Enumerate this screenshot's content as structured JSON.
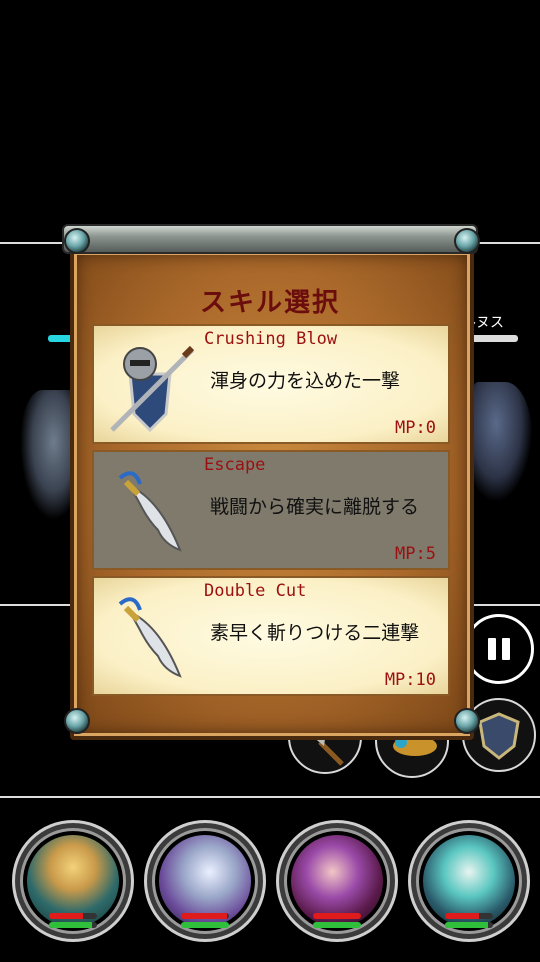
{
  "enemy": {
    "name": "ルヌス"
  },
  "dialog": {
    "title": "スキル選択",
    "skills": [
      {
        "name": "Crushing Blow",
        "description": "渾身の力を込めた一撃",
        "mp": "MP:0",
        "icon": "sword-and-shield-icon",
        "selected": false
      },
      {
        "name": "Escape",
        "description": "戦闘から確実に離脱する",
        "mp": "MP:5",
        "icon": "curved-blade-icon",
        "selected": true
      },
      {
        "name": "Double Cut",
        "description": "素早く斬りつける二連撃",
        "mp": "MP:10",
        "icon": "curved-blade-icon",
        "selected": false
      }
    ]
  },
  "party": [
    {
      "member": "blonde-swordsman",
      "hp": 0.7,
      "mp": 0.9
    },
    {
      "member": "white-griffin",
      "hp": 0.95,
      "mp": 1.0
    },
    {
      "member": "purple-hair-fighter",
      "hp": 1.0,
      "mp": 1.0
    },
    {
      "member": "teal-hair-mage",
      "hp": 0.7,
      "mp": 0.9
    }
  ],
  "colors": {
    "hp": "#e01b1b",
    "mp": "#2fbf3a",
    "title": "#6b0d0d",
    "skill_name": "#9b1010"
  }
}
